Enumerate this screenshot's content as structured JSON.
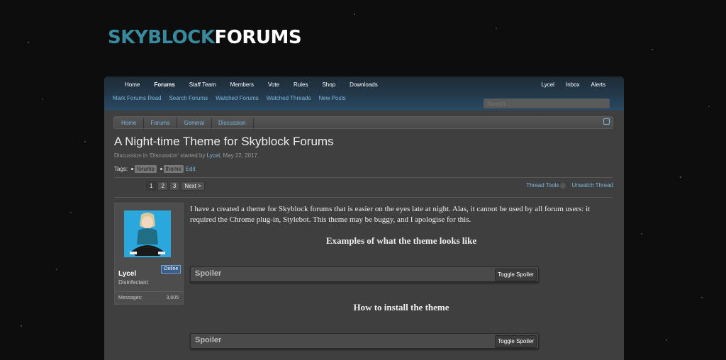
{
  "logo": {
    "part1": "SKYBLOCK",
    "part2": "FORUMS"
  },
  "nav": {
    "tabs": [
      "Home",
      "Forums",
      "Staff Team",
      "Members",
      "Vote",
      "Rules",
      "Shop",
      "Downloads"
    ],
    "active_tab": "Forums",
    "right_tabs": [
      "Lycel",
      "Inbox",
      "Alerts"
    ],
    "sub_links": [
      "Mark Forums Read",
      "Search Forums",
      "Watched Forums",
      "Watched Threads",
      "New Posts"
    ],
    "search_placeholder": "Search..."
  },
  "breadcrumbs": [
    "Home",
    "Forums",
    "General",
    "Discussion"
  ],
  "thread": {
    "title": "A Night-time Theme for Skyblock Forums",
    "meta_prefix": "Discussion in 'Discussion' started by ",
    "author": "Lycel",
    "date": ", May 22, 2017.",
    "tags_label": "Tags:",
    "tags": [
      "forums",
      "theme"
    ],
    "tags_edit": "Edit"
  },
  "pagination": {
    "pages": [
      "1",
      "2",
      "3"
    ],
    "current": "1",
    "next": "Next >"
  },
  "thread_tools": {
    "tools": "Thread Tools",
    "unwatch": "Unwatch Thread"
  },
  "user": {
    "name": "Lycel",
    "title": "Disinfectant",
    "badge": "Online",
    "stat_label": "Messages:",
    "stat_value": "3,605"
  },
  "post": {
    "body": "I have a created a theme for Skyblock forums that is easier on the eyes late at night. Alas, it cannot be used by all forum users: it required the Chrome plug-in, Stylebot. This theme may be buggy, and I apologise for this.",
    "heading1": "Examples of what the theme looks like",
    "heading2": "How to install the theme",
    "spoiler_label": "Spoiler",
    "spoiler_toggle": "Toggle Spoiler"
  },
  "colors": {
    "accent_link": "#7fb6dd",
    "nav_dark": "#1e2b36",
    "logo_teal": "#3a8a9e"
  }
}
